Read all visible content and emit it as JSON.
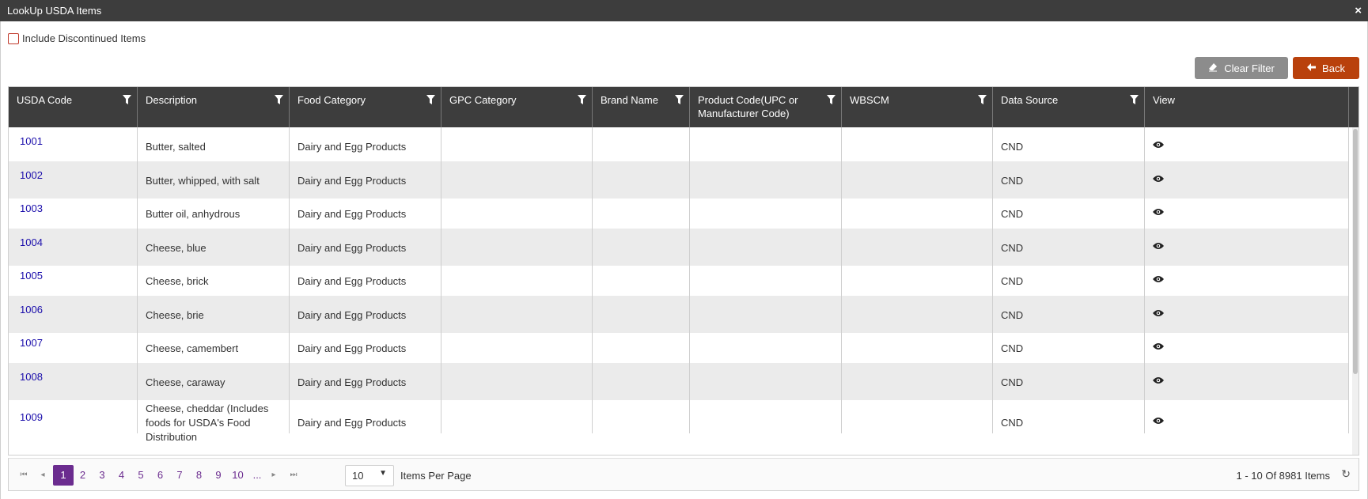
{
  "window": {
    "title": "LookUp USDA Items",
    "close_glyph": "×"
  },
  "filter_checkbox": {
    "label": "Include Discontinued Items",
    "checked": false
  },
  "buttons": {
    "clear_filter": "Clear Filter",
    "back": "Back",
    "clear_icon": "eraser-icon",
    "back_icon": "arrow-left-icon"
  },
  "colors": {
    "header_bg": "#3d3d3d",
    "back_btn": "#b9410c",
    "clear_btn": "#8c8c8c",
    "link": "#1a0dab",
    "pager_active": "#6b2c8f"
  },
  "columns": [
    {
      "label": "USDA Code",
      "filter": true
    },
    {
      "label": "Description",
      "filter": true
    },
    {
      "label": "Food Category",
      "filter": true
    },
    {
      "label": "GPC Category",
      "filter": true
    },
    {
      "label": "Brand Name",
      "filter": true
    },
    {
      "label": "Product Code(UPC or Manufacturer Code)",
      "filter": true
    },
    {
      "label": "WBSCM",
      "filter": true
    },
    {
      "label": "Data Source",
      "filter": true
    },
    {
      "label": "View",
      "filter": false
    }
  ],
  "rows": [
    {
      "code": "1001",
      "description": "Butter, salted",
      "food_category": "Dairy and Egg Products",
      "gpc": "",
      "brand": "",
      "product_code": "",
      "wbscm": "",
      "source": "CND"
    },
    {
      "code": "1002",
      "description": "Butter, whipped, with salt",
      "food_category": "Dairy and Egg Products",
      "gpc": "",
      "brand": "",
      "product_code": "",
      "wbscm": "",
      "source": "CND"
    },
    {
      "code": "1003",
      "description": "Butter oil, anhydrous",
      "food_category": "Dairy and Egg Products",
      "gpc": "",
      "brand": "",
      "product_code": "",
      "wbscm": "",
      "source": "CND"
    },
    {
      "code": "1004",
      "description": "Cheese, blue",
      "food_category": "Dairy and Egg Products",
      "gpc": "",
      "brand": "",
      "product_code": "",
      "wbscm": "",
      "source": "CND"
    },
    {
      "code": "1005",
      "description": "Cheese, brick",
      "food_category": "Dairy and Egg Products",
      "gpc": "",
      "brand": "",
      "product_code": "",
      "wbscm": "",
      "source": "CND"
    },
    {
      "code": "1006",
      "description": "Cheese, brie",
      "food_category": "Dairy and Egg Products",
      "gpc": "",
      "brand": "",
      "product_code": "",
      "wbscm": "",
      "source": "CND"
    },
    {
      "code": "1007",
      "description": "Cheese, camembert",
      "food_category": "Dairy and Egg Products",
      "gpc": "",
      "brand": "",
      "product_code": "",
      "wbscm": "",
      "source": "CND"
    },
    {
      "code": "1008",
      "description": "Cheese, caraway",
      "food_category": "Dairy and Egg Products",
      "gpc": "",
      "brand": "",
      "product_code": "",
      "wbscm": "",
      "source": "CND"
    },
    {
      "code": "1009",
      "description": "Cheese, cheddar (Includes foods for USDA's Food Distribution",
      "food_category": "Dairy and Egg Products",
      "gpc": "",
      "brand": "",
      "product_code": "",
      "wbscm": "",
      "source": "CND"
    }
  ],
  "pager": {
    "first_glyph": "⏮",
    "prev_glyph": "◂",
    "next_glyph": "▸",
    "last_glyph": "⏭",
    "pages": [
      "1",
      "2",
      "3",
      "4",
      "5",
      "6",
      "7",
      "8",
      "9",
      "10",
      "..."
    ],
    "active_page": "1",
    "items_per_page_value": "10",
    "items_per_page_label": "Items Per Page",
    "summary": "1 - 10 Of 8981 Items",
    "refresh_glyph": "↻"
  }
}
